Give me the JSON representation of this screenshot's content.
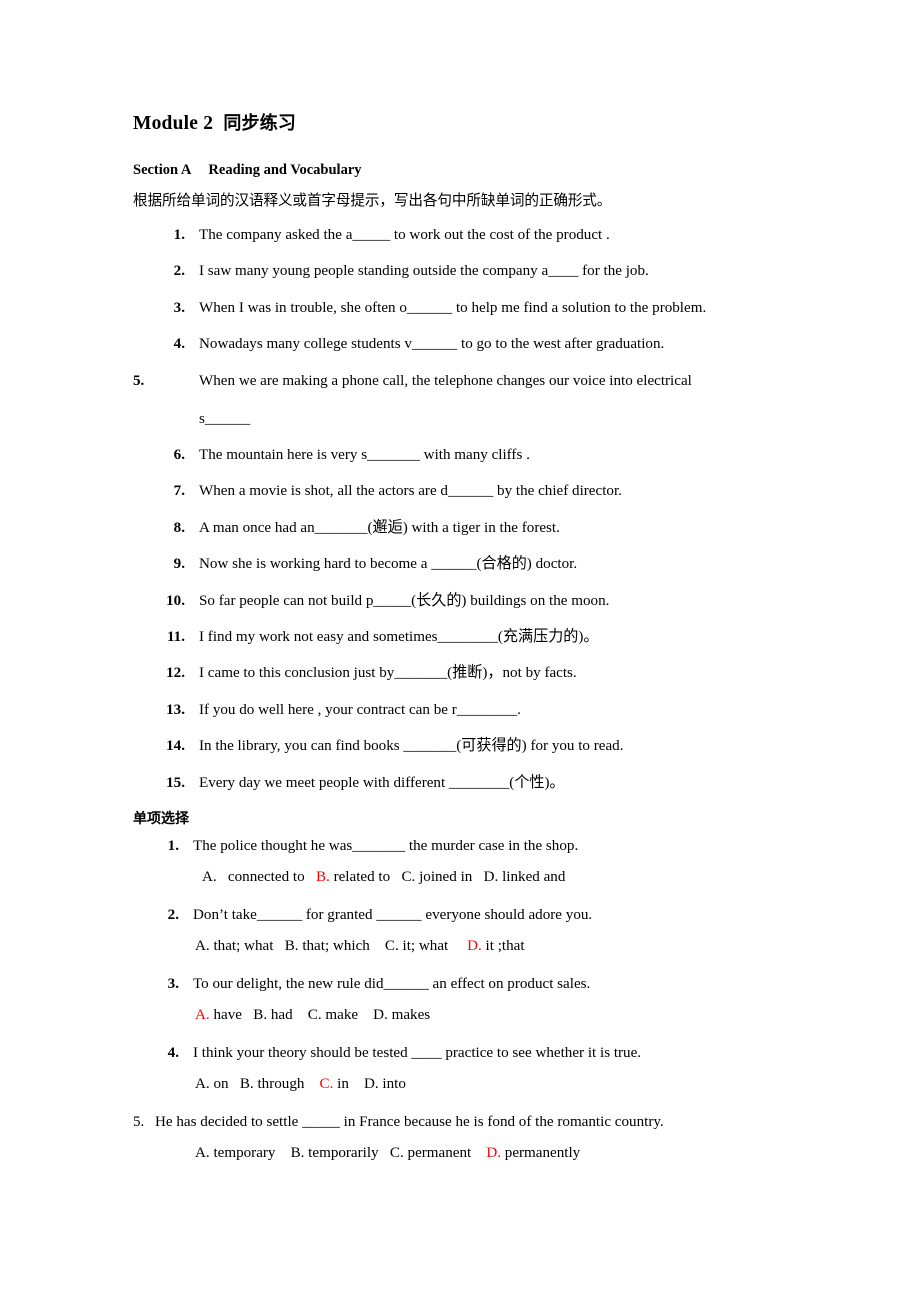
{
  "document": {
    "title_en": "Module 2",
    "title_cjk": "同步练习",
    "section_a_label": "Section A",
    "section_a_name": "Reading and Vocabulary",
    "instruction": "根据所给单词的汉语释义或首字母提示，写出各句中所缺单词的正确形式。",
    "mc_heading": "单项选择",
    "answer_color": "#ff0000"
  },
  "vocabulary_questions": [
    {
      "num": "1.",
      "text": "The company asked the   a_____ to work out the cost of the product ."
    },
    {
      "num": "2.",
      "text": "I saw many young people standing outside the company a____ for the job."
    },
    {
      "num": "3.",
      "text": "When I was in trouble, she often o______ to help me find a solution to the problem."
    },
    {
      "num": "4.",
      "text": "Nowadays many college students v______ to go to the west after graduation."
    },
    {
      "num": "5.",
      "text": "When we are making a phone call, the telephone changes our voice into electrical",
      "continuation": "s______"
    },
    {
      "num": "6.",
      "text": "The mountain here is very s_______ with many cliffs ."
    },
    {
      "num": "7.",
      "text": "When a movie is shot, all the actors are d______ by the chief director."
    },
    {
      "num": "8.",
      "text": "A man once had an_______(邂逅) with a tiger in the forest."
    },
    {
      "num": "9.",
      "text": "Now she is working hard to become a ______(合格的) doctor."
    },
    {
      "num": "10.",
      "text": "So far people can not build p_____(长久的) buildings on the moon."
    },
    {
      "num": "11.",
      "text": "I find my work not easy and sometimes________(充满压力的)。"
    },
    {
      "num": "12.",
      "text": "I came to this conclusion just by_______(推断)，not by facts."
    },
    {
      "num": "13.",
      "text": "If you do well here , your contract can be r________."
    },
    {
      "num": "14.",
      "text": "In the library, you can find books _______(可获得的) for you to read."
    },
    {
      "num": "15.",
      "text": "Every day we meet people with different ________(个性)。"
    }
  ],
  "multiple_choice": [
    {
      "num": "1.",
      "stem": "The police thought he was_______ the murder case in the shop.",
      "answer": "B",
      "options_text": " A.   connected to   B. related to   C. joined in   D. linked and",
      "options": [
        "A.   connected to",
        "B. related to",
        "C. joined in",
        "D. linked and"
      ]
    },
    {
      "num": "2.",
      "stem": "Don’t take______ for granted ______ everyone should adore you.",
      "answer": "D",
      "options_text": "A. that; what   B. that; which    C. it; what     D. it ;that",
      "options": [
        "A. that; what",
        "B. that; which",
        "C. it; what",
        "D. it ;that"
      ]
    },
    {
      "num": "3.",
      "stem": "To our delight, the new rule did______ an effect on product sales.",
      "answer": "A",
      "options_text": "A. have   B. had    C. make    D. makes",
      "options": [
        "A. have",
        "B. had",
        "C. make",
        "D. makes"
      ]
    },
    {
      "num": "4.",
      "stem": "I think your theory should be tested ____ practice to see whether it is true.",
      "answer": "C",
      "options_text": "A. on   B. through    C. in    D. into",
      "options": [
        "A. on",
        "B. through",
        "C. in",
        "D. into"
      ]
    },
    {
      "num": "5.",
      "stem": "He has decided to settle _____ in France because he is fond of the romantic country.",
      "answer": "D",
      "options_text": "A. temporary    B. temporarily   C. permanent    D. permanently",
      "options": [
        "A. temporary",
        "B. temporarily",
        "C. permanent",
        "D. permanently"
      ],
      "style": "plain"
    }
  ]
}
